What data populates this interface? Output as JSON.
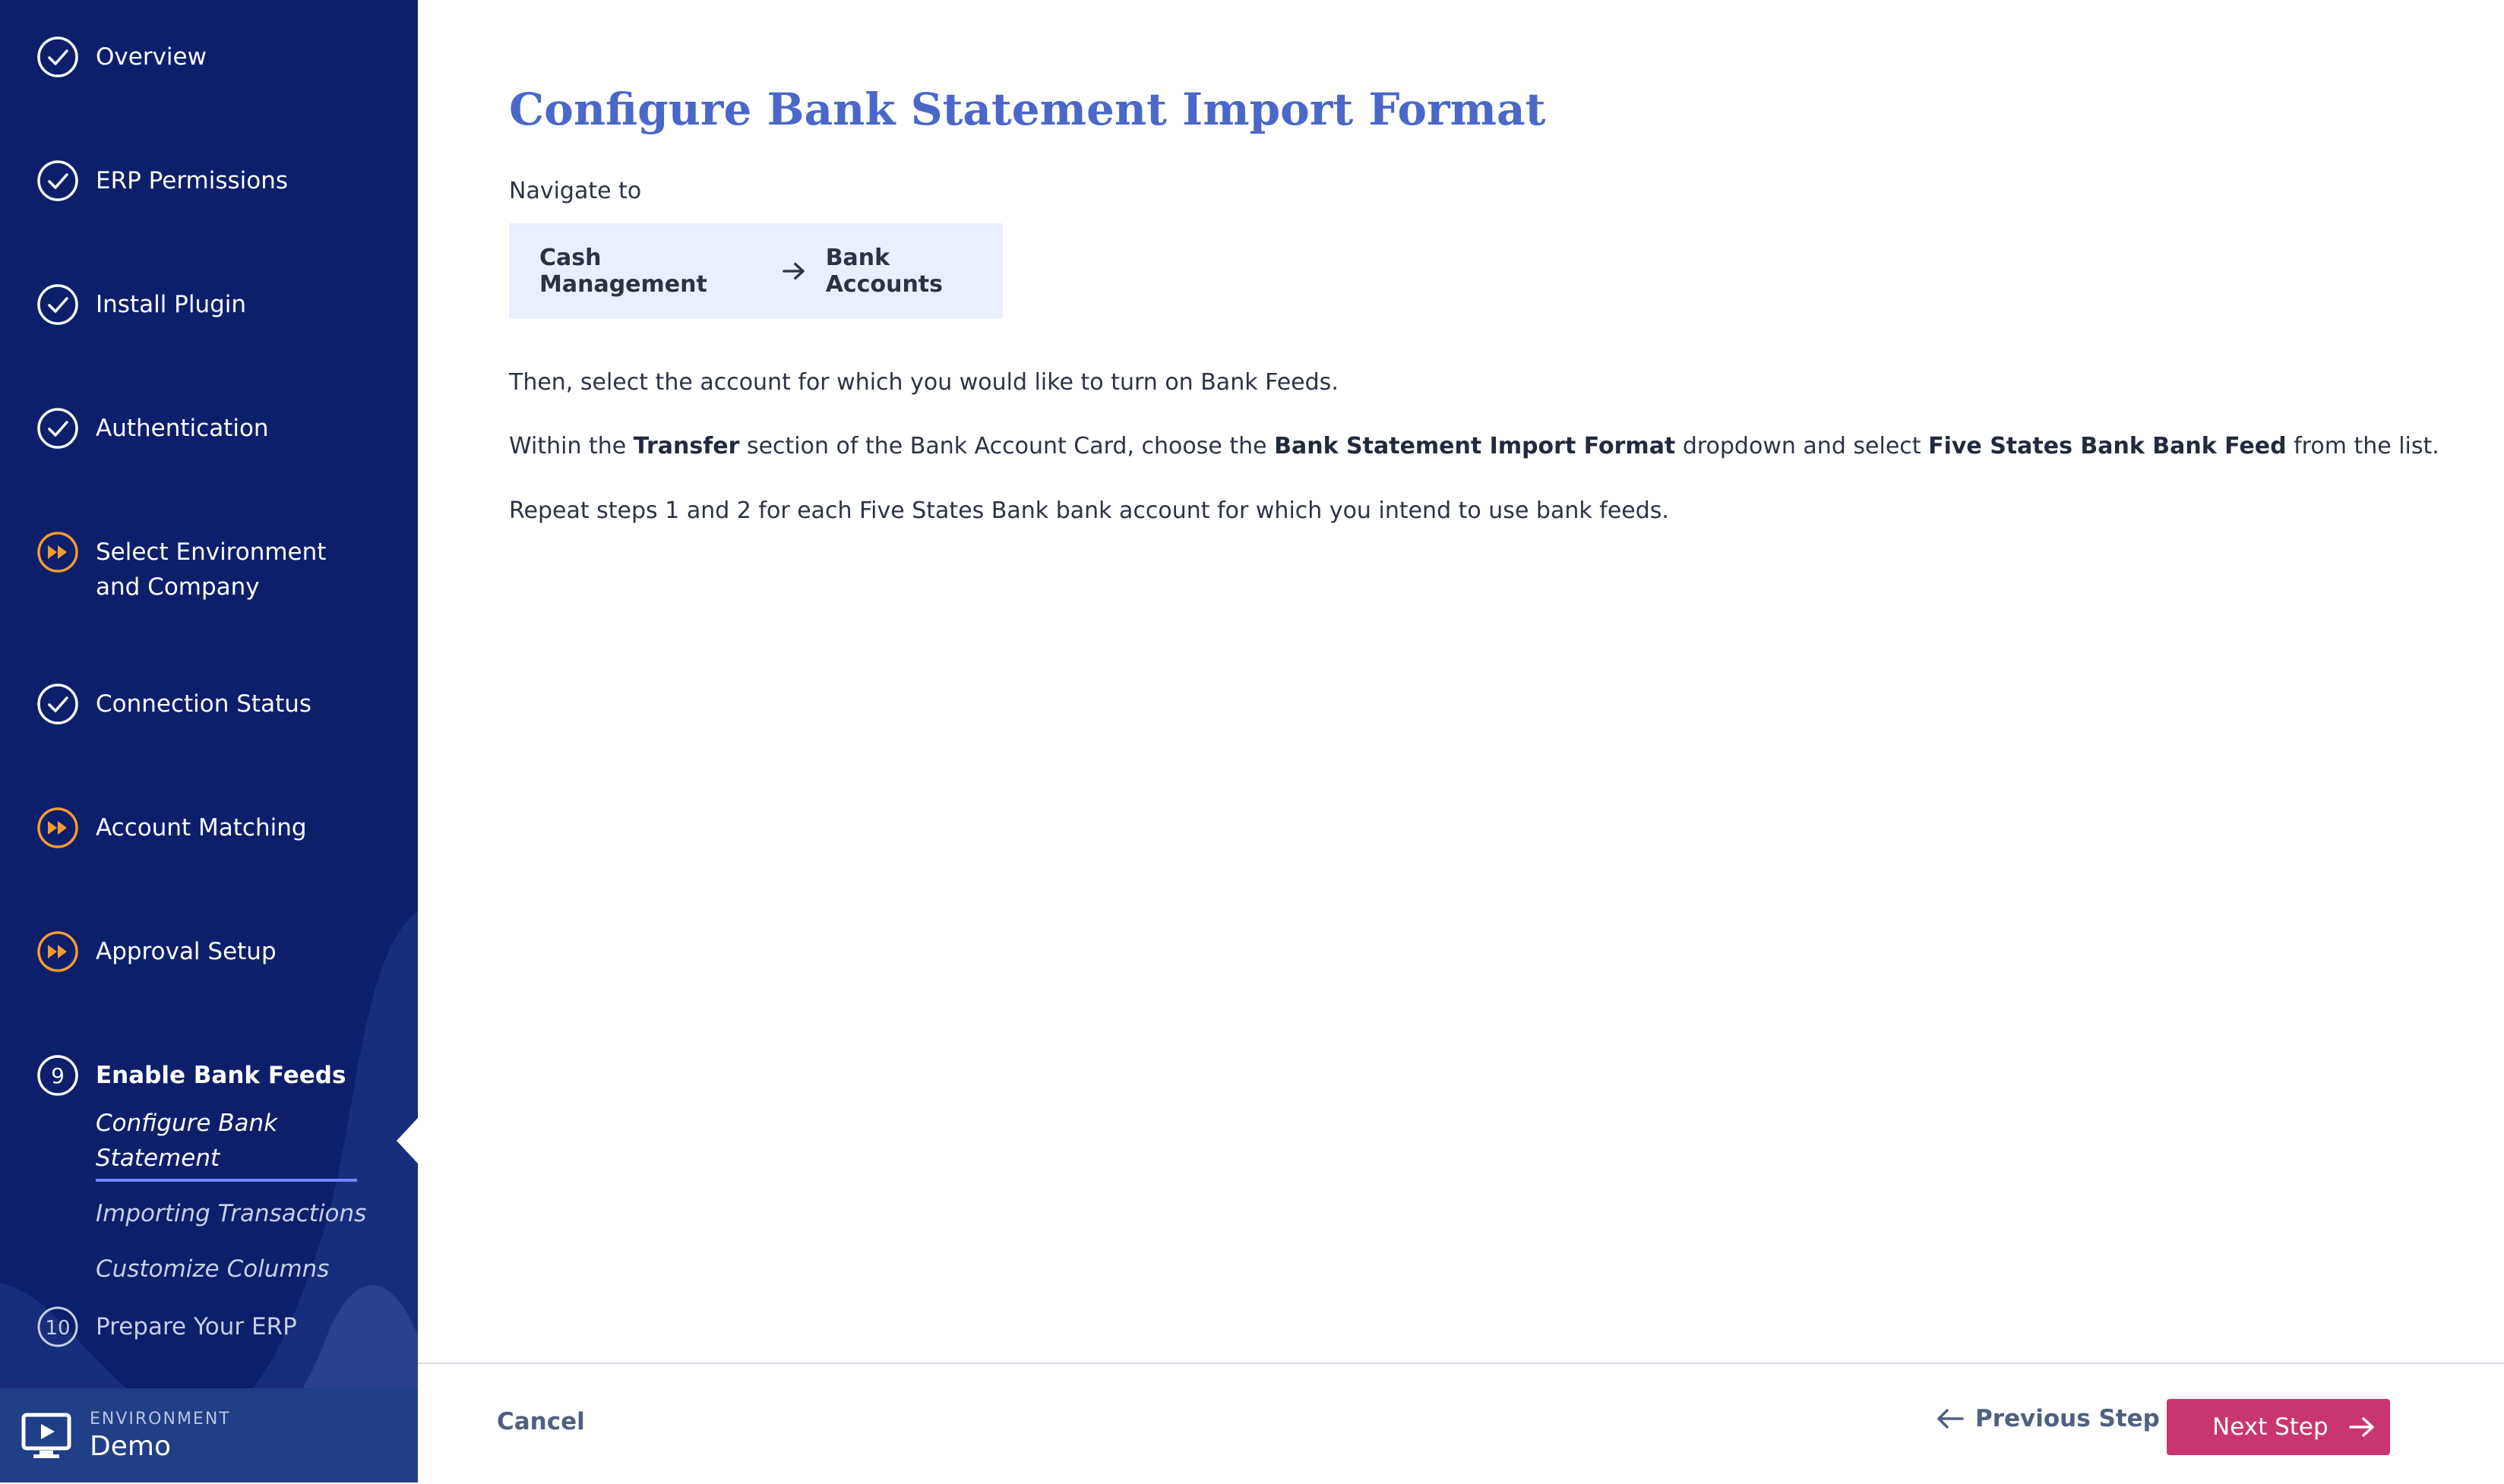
{
  "sidebar": {
    "steps": [
      {
        "label": "Overview",
        "state": "done"
      },
      {
        "label": "ERP Permissions",
        "state": "done"
      },
      {
        "label": "Install Plugin",
        "state": "done"
      },
      {
        "label": "Authentication",
        "state": "done"
      },
      {
        "label": "Select Environment and Company",
        "state": "skipped"
      },
      {
        "label": "Connection Status",
        "state": "done"
      },
      {
        "label": "Account Matching",
        "state": "skipped"
      },
      {
        "label": "Approval Setup",
        "state": "skipped"
      },
      {
        "label": "Enable Bank Feeds",
        "state": "current",
        "number": "9"
      },
      {
        "label": "Prepare Your ERP",
        "state": "pending",
        "number": "10"
      }
    ],
    "substeps": [
      {
        "label": "Configure Bank Statement",
        "active": true
      },
      {
        "label": "Importing Transactions",
        "active": false
      },
      {
        "label": "Customize Columns",
        "active": false
      }
    ],
    "environment": {
      "key": "ENVIRONMENT",
      "value": "Demo"
    }
  },
  "main": {
    "title": "Configure Bank Statement Import Format",
    "navigate_label": "Navigate to",
    "nav_path": [
      "Cash Management",
      "Bank Accounts"
    ],
    "p1": "Then, select the account for which you would like to turn on Bank Feeds.",
    "p2": {
      "t1": "Within the ",
      "b1": "Transfer",
      "t2": " section of the Bank Account Card, choose the ",
      "b2": "Bank Statement Import Format",
      "t3": " dropdown and select ",
      "b3": "Five States Bank Bank Feed",
      "t4": " from the list."
    },
    "p3": "Repeat steps 1 and 2 for each Five States Bank bank account for which you intend to use bank feeds."
  },
  "footer": {
    "cancel": "Cancel",
    "previous": "Previous Step",
    "next": "Next Step"
  },
  "colors": {
    "sidebar_bg": "#0d1f6b",
    "title": "#4a67c9",
    "next_button": "#c9366f",
    "skipped_icon": "#f39c32"
  },
  "icons": {
    "done": "check-circle-icon",
    "skipped": "fast-forward-circle-icon",
    "arrow": "arrow-right-icon",
    "back": "arrow-left-icon",
    "environment": "monitor-play-icon"
  }
}
